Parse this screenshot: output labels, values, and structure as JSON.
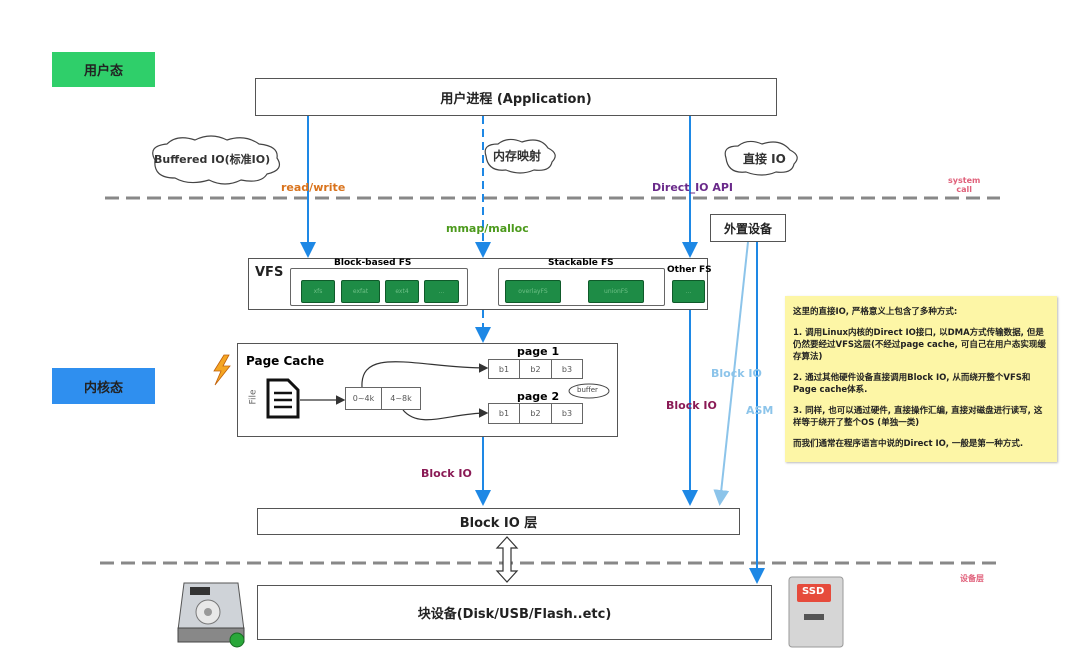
{
  "layers": {
    "user": "用户态",
    "kernel": "内核态",
    "system_call": "system\ncall",
    "device": "设备层"
  },
  "application": "用户进程 (Application)",
  "clouds": {
    "buffered": "Buffered IO(标准IO)",
    "mmap": "内存映射",
    "direct": "直接 IO"
  },
  "labels": {
    "read_write": "read/write",
    "mmap_malloc": "mmap/malloc",
    "direct_io_api": "Direct_IO API",
    "block_io_left": "Block IO",
    "block_io_right": "Block IO",
    "block_io_ext": "Block IO",
    "asm": "ASM"
  },
  "external_device": "外置设备",
  "vfs": {
    "title": "VFS",
    "block_based": {
      "title": "Block-based FS",
      "items": [
        "xfs",
        "exfat",
        "ext4",
        "..."
      ]
    },
    "stackable": {
      "title": "Stackable FS",
      "items": [
        "overlayFS",
        "unionFS"
      ]
    },
    "other": {
      "title": "Other FS",
      "items": [
        "..."
      ]
    }
  },
  "page_cache": {
    "title": "Page Cache",
    "file_label": "File",
    "ranges": [
      "0~4k",
      "4~8k"
    ],
    "pages": [
      {
        "title": "page 1",
        "blocks": [
          "b1",
          "b2",
          "b3"
        ]
      },
      {
        "title": "page 2",
        "blocks": [
          "b1",
          "b2",
          "b3"
        ]
      }
    ],
    "buffer": "buffer"
  },
  "block_io_layer": "Block IO 层",
  "block_device": "块设备(Disk/USB/Flash..etc)",
  "ssd_label": "SSD",
  "note": {
    "intro": "这里的直接IO, 严格意义上包含了多种方式:",
    "p1": "1. 调用Linux内核的Direct IO接口, 以DMA方式传输数据, 但是仍然要经过VFS这层(不经过page cache, 可自己在用户态实现缓存算法)",
    "p2": "2. 通过其他硬件设备直接调用Block IO, 从而绕开整个VFS和Page cache体系.",
    "p3": "3. 同样, 也可以通过硬件, 直接操作汇编, 直接对磁盘进行读写, 这样等于绕开了整个OS (单独一类)",
    "p4": "而我们通常在程序语言中说的Direct IO, 一般是第一种方式."
  },
  "colors": {
    "user_badge": "#2fcf6a",
    "kernel_badge": "#2f8fef",
    "arrow": "#1e88e5",
    "read_write": "#d9731c",
    "mmap": "#4c9a1c",
    "direct_api": "#6a2a8a",
    "block_io": "#8a1a55",
    "light_blue": "#8cc4ea",
    "system_call": "#e0607a",
    "fs_green": "#1e8c46",
    "note": "#fdf6a6"
  }
}
